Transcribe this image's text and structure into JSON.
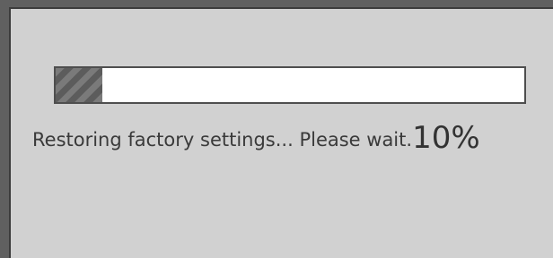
{
  "dialog": {
    "progress": {
      "value_percent": 10,
      "fill_style": "diagonal-stripes",
      "track_color": "#ffffff",
      "fill_color": "#6e6e6e"
    },
    "status_text": "Restoring factory settings... Please wait.",
    "percent_text": "10%"
  },
  "colors": {
    "panel_background": "#d1d1d1",
    "frame": "#606060",
    "text": "#3a3a3a"
  }
}
